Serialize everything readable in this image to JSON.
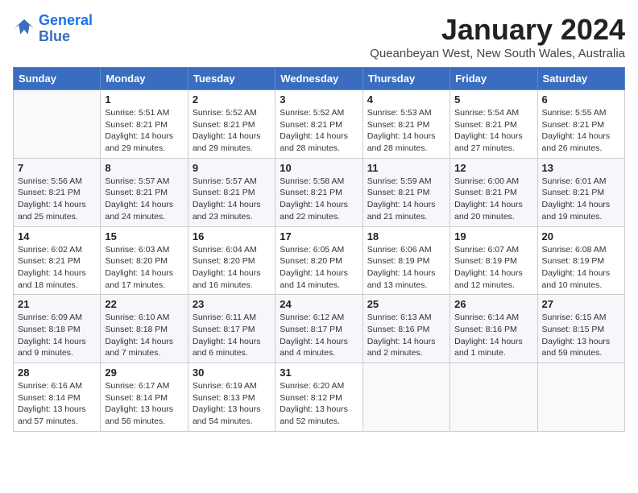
{
  "logo": {
    "line1": "General",
    "line2": "Blue"
  },
  "title": "January 2024",
  "location": "Queanbeyan West, New South Wales, Australia",
  "weekdays": [
    "Sunday",
    "Monday",
    "Tuesday",
    "Wednesday",
    "Thursday",
    "Friday",
    "Saturday"
  ],
  "weeks": [
    [
      {
        "day": "",
        "info": ""
      },
      {
        "day": "1",
        "info": "Sunrise: 5:51 AM\nSunset: 8:21 PM\nDaylight: 14 hours\nand 29 minutes."
      },
      {
        "day": "2",
        "info": "Sunrise: 5:52 AM\nSunset: 8:21 PM\nDaylight: 14 hours\nand 29 minutes."
      },
      {
        "day": "3",
        "info": "Sunrise: 5:52 AM\nSunset: 8:21 PM\nDaylight: 14 hours\nand 28 minutes."
      },
      {
        "day": "4",
        "info": "Sunrise: 5:53 AM\nSunset: 8:21 PM\nDaylight: 14 hours\nand 28 minutes."
      },
      {
        "day": "5",
        "info": "Sunrise: 5:54 AM\nSunset: 8:21 PM\nDaylight: 14 hours\nand 27 minutes."
      },
      {
        "day": "6",
        "info": "Sunrise: 5:55 AM\nSunset: 8:21 PM\nDaylight: 14 hours\nand 26 minutes."
      }
    ],
    [
      {
        "day": "7",
        "info": "Sunrise: 5:56 AM\nSunset: 8:21 PM\nDaylight: 14 hours\nand 25 minutes."
      },
      {
        "day": "8",
        "info": "Sunrise: 5:57 AM\nSunset: 8:21 PM\nDaylight: 14 hours\nand 24 minutes."
      },
      {
        "day": "9",
        "info": "Sunrise: 5:57 AM\nSunset: 8:21 PM\nDaylight: 14 hours\nand 23 minutes."
      },
      {
        "day": "10",
        "info": "Sunrise: 5:58 AM\nSunset: 8:21 PM\nDaylight: 14 hours\nand 22 minutes."
      },
      {
        "day": "11",
        "info": "Sunrise: 5:59 AM\nSunset: 8:21 PM\nDaylight: 14 hours\nand 21 minutes."
      },
      {
        "day": "12",
        "info": "Sunrise: 6:00 AM\nSunset: 8:21 PM\nDaylight: 14 hours\nand 20 minutes."
      },
      {
        "day": "13",
        "info": "Sunrise: 6:01 AM\nSunset: 8:21 PM\nDaylight: 14 hours\nand 19 minutes."
      }
    ],
    [
      {
        "day": "14",
        "info": "Sunrise: 6:02 AM\nSunset: 8:21 PM\nDaylight: 14 hours\nand 18 minutes."
      },
      {
        "day": "15",
        "info": "Sunrise: 6:03 AM\nSunset: 8:20 PM\nDaylight: 14 hours\nand 17 minutes."
      },
      {
        "day": "16",
        "info": "Sunrise: 6:04 AM\nSunset: 8:20 PM\nDaylight: 14 hours\nand 16 minutes."
      },
      {
        "day": "17",
        "info": "Sunrise: 6:05 AM\nSunset: 8:20 PM\nDaylight: 14 hours\nand 14 minutes."
      },
      {
        "day": "18",
        "info": "Sunrise: 6:06 AM\nSunset: 8:19 PM\nDaylight: 14 hours\nand 13 minutes."
      },
      {
        "day": "19",
        "info": "Sunrise: 6:07 AM\nSunset: 8:19 PM\nDaylight: 14 hours\nand 12 minutes."
      },
      {
        "day": "20",
        "info": "Sunrise: 6:08 AM\nSunset: 8:19 PM\nDaylight: 14 hours\nand 10 minutes."
      }
    ],
    [
      {
        "day": "21",
        "info": "Sunrise: 6:09 AM\nSunset: 8:18 PM\nDaylight: 14 hours\nand 9 minutes."
      },
      {
        "day": "22",
        "info": "Sunrise: 6:10 AM\nSunset: 8:18 PM\nDaylight: 14 hours\nand 7 minutes."
      },
      {
        "day": "23",
        "info": "Sunrise: 6:11 AM\nSunset: 8:17 PM\nDaylight: 14 hours\nand 6 minutes."
      },
      {
        "day": "24",
        "info": "Sunrise: 6:12 AM\nSunset: 8:17 PM\nDaylight: 14 hours\nand 4 minutes."
      },
      {
        "day": "25",
        "info": "Sunrise: 6:13 AM\nSunset: 8:16 PM\nDaylight: 14 hours\nand 2 minutes."
      },
      {
        "day": "26",
        "info": "Sunrise: 6:14 AM\nSunset: 8:16 PM\nDaylight: 14 hours\nand 1 minute."
      },
      {
        "day": "27",
        "info": "Sunrise: 6:15 AM\nSunset: 8:15 PM\nDaylight: 13 hours\nand 59 minutes."
      }
    ],
    [
      {
        "day": "28",
        "info": "Sunrise: 6:16 AM\nSunset: 8:14 PM\nDaylight: 13 hours\nand 57 minutes."
      },
      {
        "day": "29",
        "info": "Sunrise: 6:17 AM\nSunset: 8:14 PM\nDaylight: 13 hours\nand 56 minutes."
      },
      {
        "day": "30",
        "info": "Sunrise: 6:19 AM\nSunset: 8:13 PM\nDaylight: 13 hours\nand 54 minutes."
      },
      {
        "day": "31",
        "info": "Sunrise: 6:20 AM\nSunset: 8:12 PM\nDaylight: 13 hours\nand 52 minutes."
      },
      {
        "day": "",
        "info": ""
      },
      {
        "day": "",
        "info": ""
      },
      {
        "day": "",
        "info": ""
      }
    ]
  ]
}
